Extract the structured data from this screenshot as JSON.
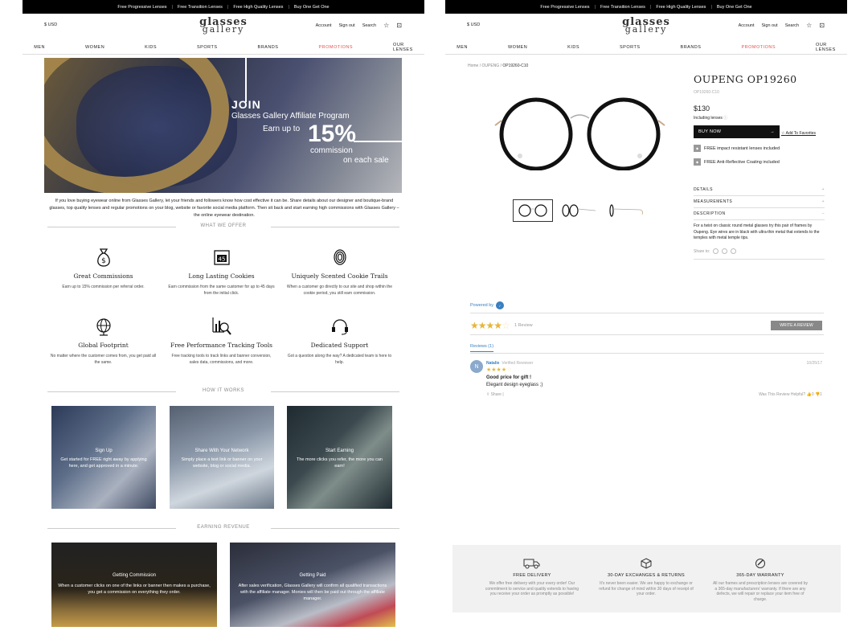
{
  "topbar": {
    "items": [
      "Free Progressive Lenses",
      "Free Transition Lenses",
      "Free High Quality Lenses",
      "Buy One Get One"
    ]
  },
  "header": {
    "currency": "$ USD",
    "logo_line1": "glasses",
    "logo_line2": "gallery",
    "account": "Account",
    "signout": "Sign out",
    "search": "Search"
  },
  "nav": {
    "items": [
      "MEN",
      "WOMEN",
      "KIDS",
      "SPORTS",
      "BRANDS",
      "PROMOTIONS",
      "OUR LENSES"
    ]
  },
  "hero": {
    "join": "JOIN",
    "program": "Glasses Gallery Affiliate Program",
    "earn": "Earn up to",
    "percent": "15%",
    "commission": "commission",
    "each_sale": "on each sale"
  },
  "intro": "If you love buying eyewear online from Glasses Gallery, let your friends and followers know how cost effective it can be. Share details about our designer and boutique-brand glasses, top quality lenses and regular promotions on your blog, website or favorite social media platform. Then sit back and start earning high commissions with Glasses Gallery – the online eyewear destination.",
  "sections": {
    "offer": "WHAT WE OFFER",
    "how": "HOW IT WORKS",
    "revenue": "EARNING REVENUE"
  },
  "features": [
    {
      "icon": "money-bag-icon",
      "title": "Great Commissions",
      "desc": "Earn up to 15% commission per referral order."
    },
    {
      "icon": "calendar-icon",
      "title": "Long Lasting Cookies",
      "desc": "Earn commission from the same customer for up to 45 days from the initial click.",
      "badge": "45"
    },
    {
      "icon": "fingerprint-icon",
      "title": "Uniquely Scented Cookie Trails",
      "desc": "When a customer go directly to our site and shop within the cookie period, you still earn commission."
    },
    {
      "icon": "globe-icon",
      "title": "Global Footprint",
      "desc": "No matter where the customer comes from, you get paid all the same."
    },
    {
      "icon": "chart-magnifier-icon",
      "title": "Free Performance Tracking Tools",
      "desc": "Free tracking tools to track links and banner conversion, sales data, commissions, and more."
    },
    {
      "icon": "headset-icon",
      "title": "Dedicated Support",
      "desc": "Got a question along the way? A dedicated team is here to help."
    }
  ],
  "steps": [
    {
      "title": "Sign Up",
      "desc": "Get started for FREE right away by applying here, and get approved in a minute."
    },
    {
      "title": "Share With Your Network",
      "desc": "Simply place a text link or banner on your website, blog or social media."
    },
    {
      "title": "Start Earning",
      "desc": "The more clicks you refer, the more you can earn!"
    }
  ],
  "revenue": [
    {
      "title": "Getting Commission",
      "desc": "When a customer clicks on one of the links or banner then makes a purchase, you get a commission on everything they order."
    },
    {
      "title": "Getting Paid",
      "desc": "After sales verification, Glasses Gallery will confirm all qualified transactions with the affiliate manager. Monies will then be paid out through the affiliate manager."
    }
  ],
  "product": {
    "breadcrumb_home": "Home",
    "breadcrumb_brand": "OUPENG",
    "breadcrumb_current": "OP19260-C10",
    "name": "OUPENG OP19260",
    "sku": "OP19260-C10",
    "price": "$130",
    "including": "Including lenses",
    "buy": "BUY NOW",
    "favorite": "Add To Favorites",
    "perk1": "FREE impact resistant lenses included",
    "perk2": "FREE Anti-Reflective Coating included",
    "acc_details": "DETAILS",
    "acc_measure": "MEASUREMENTS",
    "acc_desc": "DESCRIPTION",
    "description": "For a twist on classic round metal glasses try this pair of frames by Oupeng. Eye wires are in black with ultra-thin metal that extends to the temples with metal temple tips.",
    "share": "Share to:"
  },
  "reviews": {
    "powered": "Powered by",
    "rating": 4,
    "count": "1 Review",
    "write": "WRITE A REVIEW",
    "tab": "Reviews (1)",
    "avatar": "N",
    "name": "Natalie",
    "verified": "Verified Reviewer",
    "date": "10/25/17",
    "stars": 4,
    "title": "Good price for gift !",
    "body": "Elegant design eyeglass ;)",
    "share": "Share",
    "helpful": "Was This Review Helpful?",
    "up": "0",
    "down": "1"
  },
  "footer": [
    {
      "icon": "truck-icon",
      "title": "FREE DELIVERY",
      "desc": "We offer free delivery with your every order! Our commitment to service and quality extends to having you receive your order as promptly as possible!"
    },
    {
      "icon": "box-icon",
      "title": "30-DAY EXCHANGES & RETURNS",
      "desc": "It's never been easier. We are happy to exchange or refund for change of mind within 30 days of receipt of your order."
    },
    {
      "icon": "warranty-icon",
      "title": "365-DAY WARRANTY",
      "desc": "All our frames and prescription lenses are covered by a 365-day manufacturers' warranty. If there are any defects, we will repair or replace your item free of charge."
    }
  ],
  "colors": {
    "promo": "#e2534f",
    "accent_blue": "#3a7fc1",
    "star": "#e6b63b"
  }
}
